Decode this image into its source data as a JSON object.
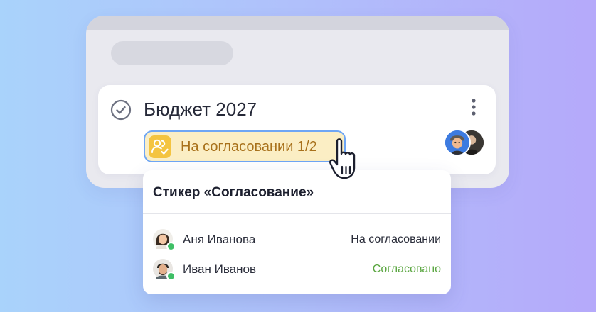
{
  "task": {
    "title": "Бюджет 2027",
    "status_chip": {
      "label": "На согласовании 1/2",
      "icon": "people-check-icon"
    },
    "avatars": [
      "assignee-avatar-1",
      "assignee-avatar-2"
    ]
  },
  "popover": {
    "title": "Стикер «Согласование»",
    "approvers": [
      {
        "name": "Аня Иванова",
        "status": "На согласовании",
        "status_color": "#2b2e3b",
        "online": true
      },
      {
        "name": "Иван Иванов",
        "status": "Согласовано",
        "status_color": "#5aa640",
        "online": true
      }
    ]
  },
  "colors": {
    "chip_bg": "#fbeec4",
    "chip_border": "#6ea6f5",
    "chip_icon_bg": "#f4c440",
    "chip_text": "#a8711b",
    "approved": "#5aa640",
    "presence": "#3fbf66"
  }
}
